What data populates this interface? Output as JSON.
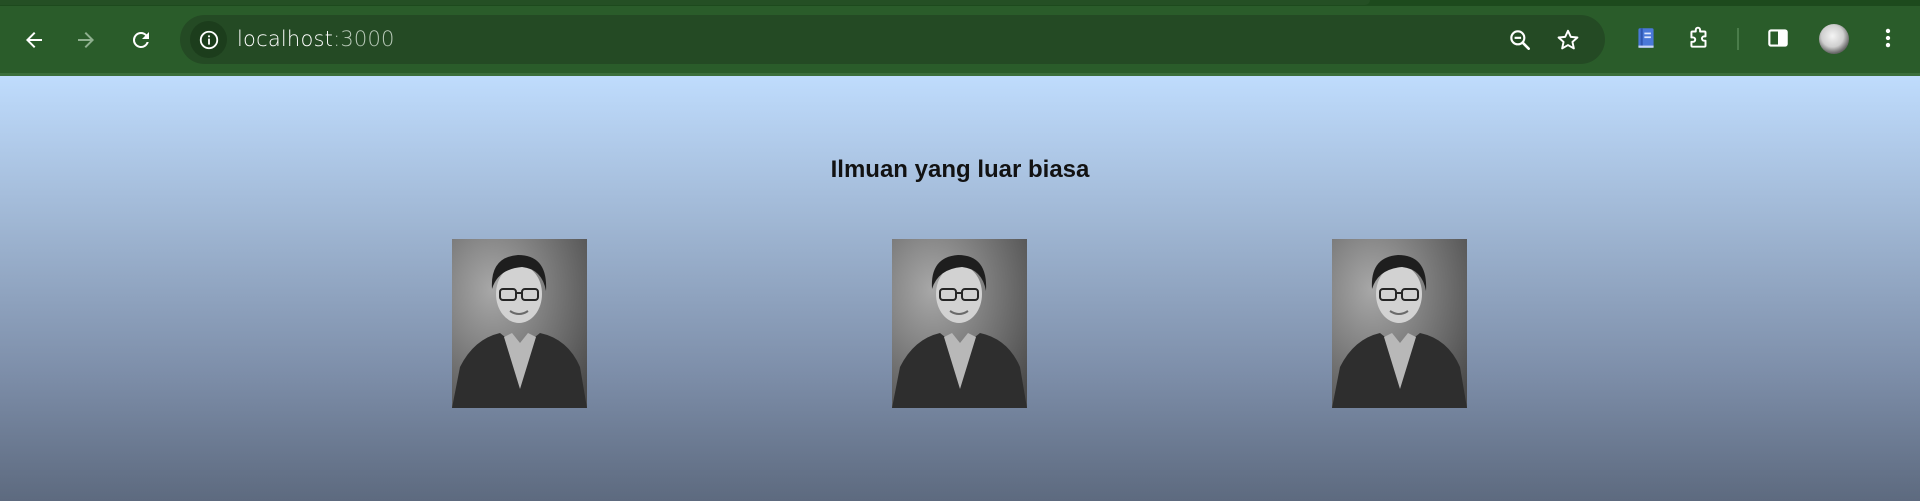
{
  "browser": {
    "url_host": "localhost",
    "url_port": ":3000",
    "icons": {
      "back": "arrow-left-icon",
      "forward": "arrow-right-icon",
      "reload": "reload-icon",
      "site_info": "info-icon",
      "zoom": "zoom-out-icon",
      "bookmark": "star-icon",
      "extension_book": "book-icon",
      "extensions": "puzzle-icon",
      "side_panel": "side-panel-icon",
      "menu": "kebab-menu-icon"
    },
    "colors": {
      "toolbar": "#2a5c2a",
      "omnibox": "#244a24"
    }
  },
  "page": {
    "heading": "Ilmuan yang luar biasa",
    "gallery": [
      {
        "subject": "scientist-portrait"
      },
      {
        "subject": "scientist-portrait"
      },
      {
        "subject": "scientist-portrait"
      }
    ]
  }
}
